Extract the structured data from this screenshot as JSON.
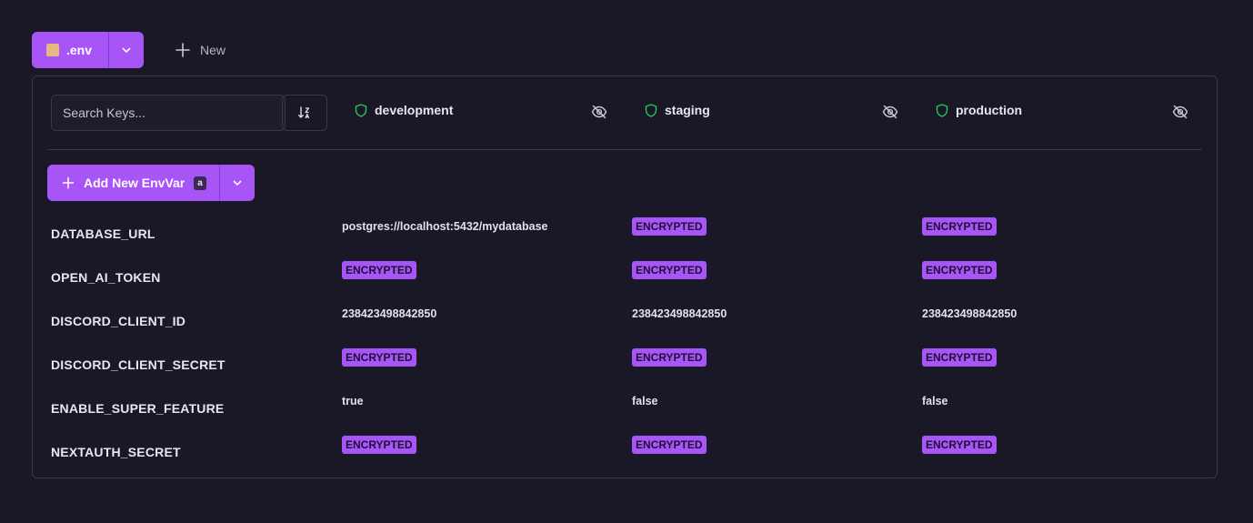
{
  "topbar": {
    "file_label": ".env",
    "new_label": "New"
  },
  "toolbar": {
    "search_placeholder": "Search Keys..."
  },
  "environments": [
    {
      "name": "development",
      "accent": "#22c55e"
    },
    {
      "name": "staging",
      "accent": "#22c55e"
    },
    {
      "name": "production",
      "accent": "#22c55e"
    }
  ],
  "add_button": {
    "label": "Add New EnvVar",
    "shortcut": "a"
  },
  "rows": [
    {
      "key": "DATABASE_URL",
      "values": [
        "postgres://localhost:5432/mydatabase",
        "ENCRYPTED",
        "ENCRYPTED"
      ]
    },
    {
      "key": "OPEN_AI_TOKEN",
      "values": [
        "ENCRYPTED",
        "ENCRYPTED",
        "ENCRYPTED"
      ]
    },
    {
      "key": "DISCORD_CLIENT_ID",
      "values": [
        "238423498842850",
        "238423498842850",
        "238423498842850"
      ]
    },
    {
      "key": "DISCORD_CLIENT_SECRET",
      "values": [
        "ENCRYPTED",
        "ENCRYPTED",
        "ENCRYPTED"
      ]
    },
    {
      "key": "ENABLE_SUPER_FEATURE",
      "values": [
        "true",
        "false",
        "false"
      ]
    },
    {
      "key": "NEXTAUTH_SECRET",
      "values": [
        "ENCRYPTED",
        "ENCRYPTED",
        "ENCRYPTED"
      ]
    }
  ],
  "colors": {
    "accent": "#a855f7",
    "background": "#1a1826",
    "border": "#3a3748"
  }
}
